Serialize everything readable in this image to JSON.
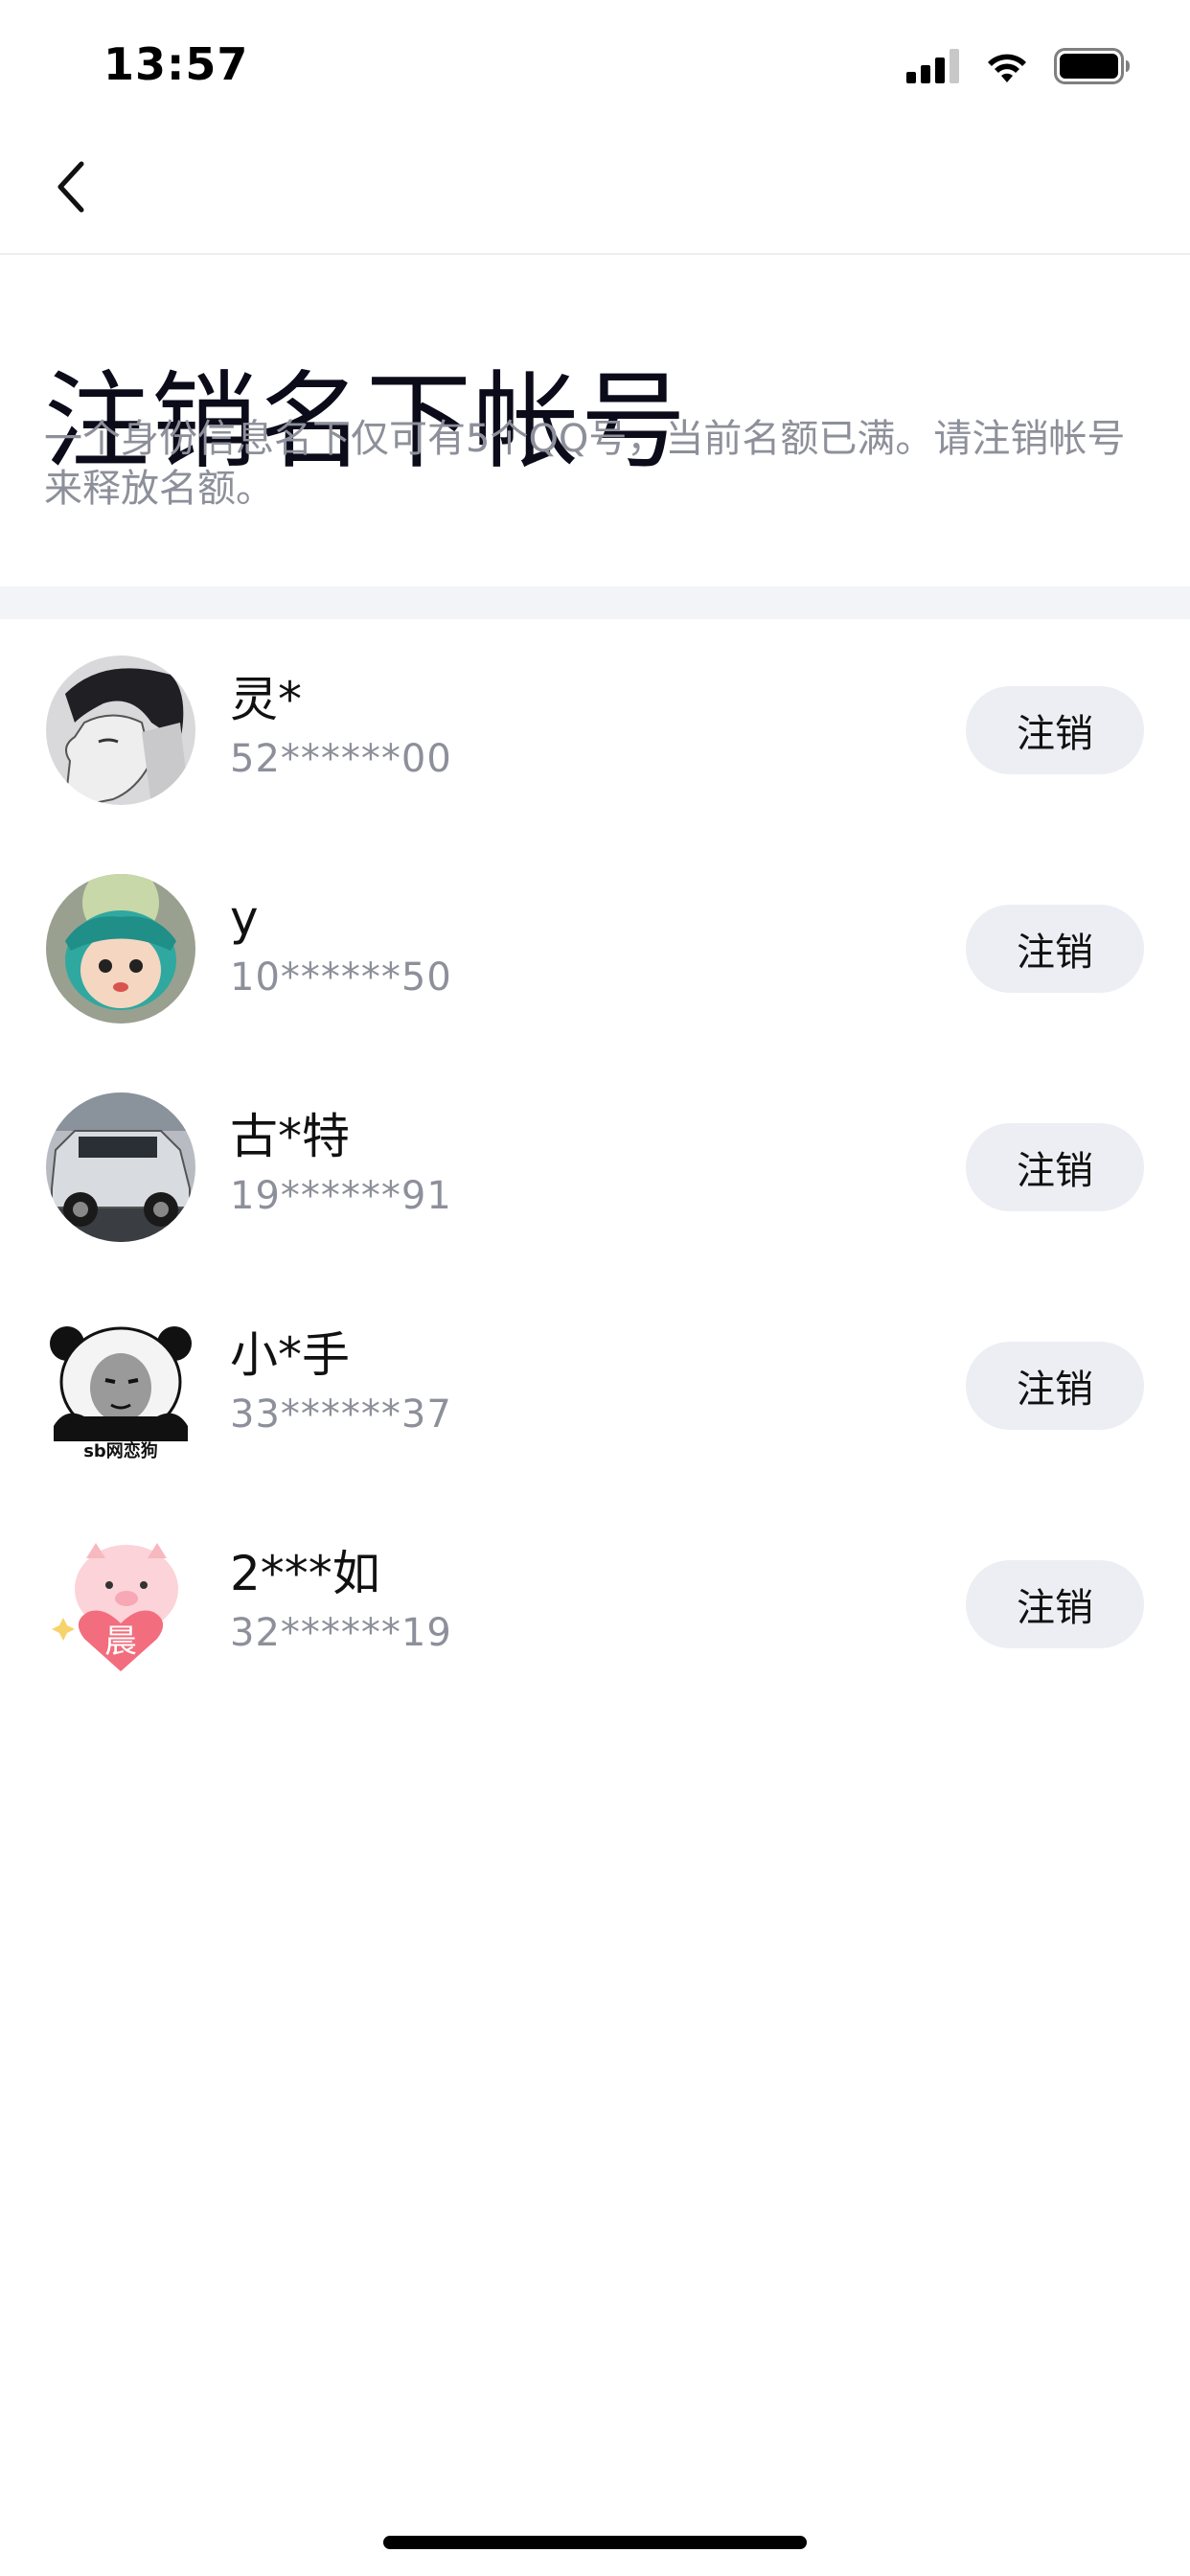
{
  "status_bar": {
    "time": "13:57"
  },
  "header": {
    "title": "注销名下帐号",
    "description": "一个身份信息名下仅可有5个QQ号，当前名额已满。请注销帐号来释放名额。"
  },
  "accounts": [
    {
      "name": "灵*",
      "number": "52******00",
      "button_label": "注销",
      "avatar": "anime-boy-avatar"
    },
    {
      "name": "y",
      "number": "10******50",
      "button_label": "注销",
      "avatar": "figure-doll-avatar"
    },
    {
      "name": "古*特",
      "number": "19******91",
      "button_label": "注销",
      "avatar": "suv-car-avatar"
    },
    {
      "name": "小*手",
      "number": "33******37",
      "button_label": "注销",
      "avatar": "panda-meme-avatar",
      "avatar_caption": "sb网恋狗"
    },
    {
      "name": "2***如",
      "number": "32******19",
      "button_label": "注销",
      "avatar": "pink-pig-avatar",
      "avatar_caption": "晨"
    }
  ],
  "colors": {
    "title": "#0b0b1a",
    "secondary_text": "#8d909a",
    "button_bg": "#eceef3",
    "divider": "#f3f4f7"
  }
}
